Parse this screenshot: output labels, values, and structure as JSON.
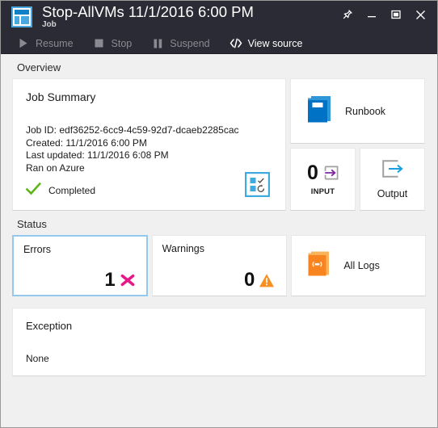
{
  "window": {
    "title": "Stop-AllVMs 11/1/2016 6:00 PM",
    "subtitle": "Job",
    "app_icon": "azure-portal-icon",
    "controls": [
      {
        "name": "pin-button",
        "icon": "pin-icon"
      },
      {
        "name": "minimize-button",
        "icon": "minimize-icon"
      },
      {
        "name": "maximize-button",
        "icon": "maximize-icon"
      },
      {
        "name": "close-button",
        "icon": "close-icon"
      }
    ],
    "titlebar_color": "#2b2b35",
    "background_color": "#f0f0f0"
  },
  "commandbar": {
    "items": [
      {
        "label": "Resume",
        "icon": "play-icon",
        "enabled": false
      },
      {
        "label": "Stop",
        "icon": "stop-square-icon",
        "enabled": false
      },
      {
        "label": "Suspend",
        "icon": "pause-icon",
        "enabled": false
      },
      {
        "label": "View source",
        "icon": "code-brackets-icon",
        "enabled": true
      }
    ]
  },
  "overview": {
    "section_label": "Overview",
    "job_summary": {
      "title": "Job Summary",
      "job_id": "Job ID: edf36252-6cc9-4c59-92d7-dcaeb2285cac",
      "created": "Created: 11/1/2016 6:00 PM",
      "last_updated": "Last updated: 11/1/2016 6:08 PM",
      "ran_on": "Ran on Azure",
      "status": "Completed",
      "status_color": "#5cb615",
      "corner_icon": "job-checklist-icon"
    },
    "runbook": {
      "label": "Runbook",
      "icon": "blue-book-icon",
      "icon_color": "#0072c6"
    },
    "input": {
      "count": "0",
      "label": "INPUT",
      "icon": "arrow-into-box-icon",
      "icon_color": "#7a20a0"
    },
    "output": {
      "label": "Output",
      "icon": "arrow-out-of-box-icon",
      "icon_color": "#1a9ede"
    }
  },
  "status": {
    "section_label": "Status",
    "errors": {
      "label": "Errors",
      "count": "1",
      "icon": "error-x-icon",
      "icon_color": "#e8188a",
      "selected": true
    },
    "warnings": {
      "label": "Warnings",
      "count": "0",
      "icon": "warning-triangle-icon",
      "icon_color": "#f79021",
      "selected": false
    },
    "all_logs": {
      "label": "All Logs",
      "icon": "orange-book-broadcast-icon",
      "icon_color": "#f7841f"
    }
  },
  "exception": {
    "title": "Exception",
    "body": "None"
  }
}
